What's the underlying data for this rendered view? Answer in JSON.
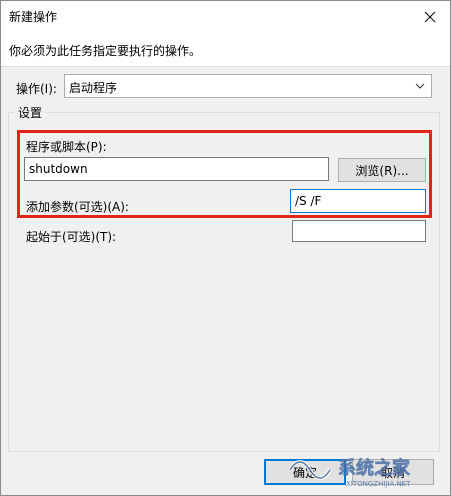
{
  "window": {
    "title": "新建操作"
  },
  "instruction": "你必须为此任务指定要执行的操作。",
  "action": {
    "label": "操作(I):",
    "selected": "启动程序"
  },
  "settings": {
    "legend": "设置",
    "program_label": "程序或脚本(P):",
    "program_value": "shutdown",
    "browse_label": "浏览(R)...",
    "args_label": "添加参数(可选)(A):",
    "args_value": "/S /F",
    "start_label": "起始于(可选)(T):",
    "start_value": ""
  },
  "buttons": {
    "ok": "确定",
    "cancel": "取消"
  },
  "watermark": {
    "text": "系统之家",
    "subtext": "XITONGZHIJIA.NET"
  },
  "colors": {
    "highlight": "#e2231a",
    "focus": "#0078d7"
  }
}
